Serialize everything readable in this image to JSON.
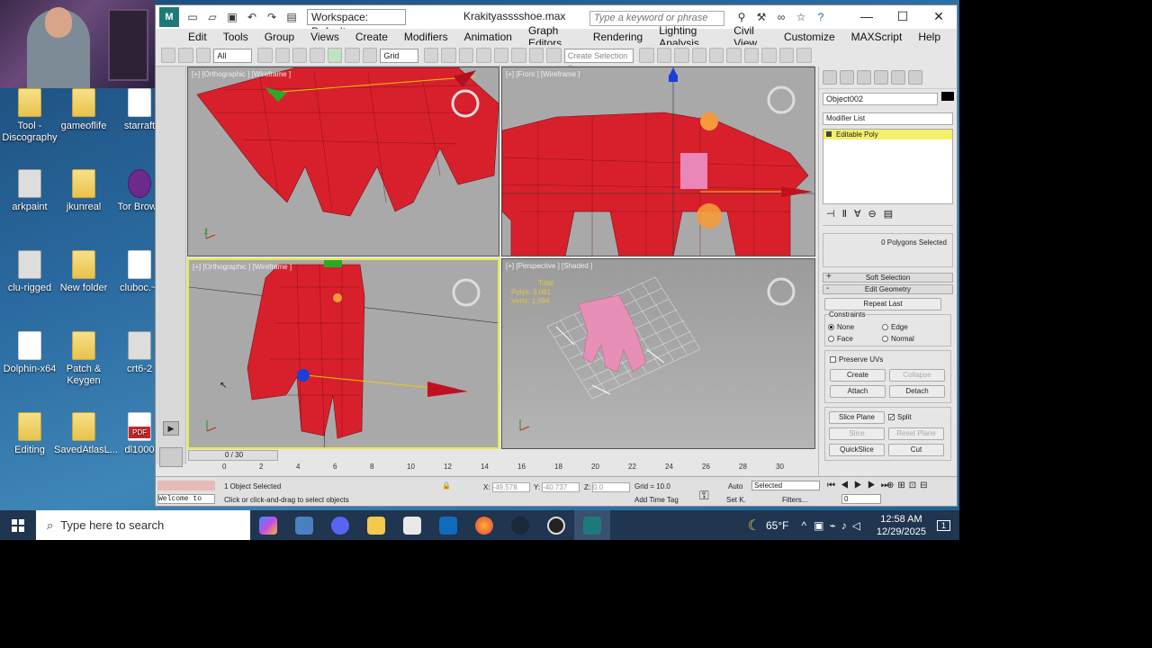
{
  "desktop": {
    "icons": [
      {
        "label": "Tool -\nDiscography",
        "kind": "folder"
      },
      {
        "label": "gameoflife",
        "kind": "folder"
      },
      {
        "label": "starraft",
        "kind": "doc"
      },
      {
        "label": "arkpaint",
        "kind": "app"
      },
      {
        "label": "jkunreal",
        "kind": "folder"
      },
      {
        "label": "Tor Brows",
        "kind": "tor"
      },
      {
        "label": "clu-rigged",
        "kind": "app"
      },
      {
        "label": "New folder",
        "kind": "folder"
      },
      {
        "label": "cluboc.~j",
        "kind": "doc"
      },
      {
        "label": "Dolphin-x64",
        "kind": "doc"
      },
      {
        "label": "Patch &\nKeygen",
        "kind": "folder"
      },
      {
        "label": "crt6-2",
        "kind": "app"
      },
      {
        "label": "Editing",
        "kind": "folder"
      },
      {
        "label": "SavedAtlasL...",
        "kind": "folder"
      },
      {
        "label": "dl1000",
        "kind": "pdf"
      }
    ]
  },
  "app": {
    "doc_title": "Krakityasssshoe.max",
    "workspace": "Workspace: Default",
    "search_placeholder": "Type a keyword or phrase",
    "menu": [
      "Edit",
      "Tools",
      "Group",
      "Views",
      "Create",
      "Modifiers",
      "Animation",
      "Graph Editors",
      "Rendering",
      "Lighting Analysis",
      "Civil View",
      "Customize",
      "MAXScript",
      "Help"
    ],
    "toolbar": {
      "selection_filter": "All",
      "ref_coord": "Grid",
      "named_selection_placeholder": "Create Selection Se"
    },
    "viewports": [
      {
        "label": "[+] [Orthographic ] [Wireframe ]"
      },
      {
        "label": "[+] [Front ] [Wireframe ]"
      },
      {
        "label": "[+] [Orthographic ] [Wireframe ]"
      },
      {
        "label": "[+] [Perspective ] [Shaded ]"
      }
    ],
    "stats": {
      "title": "Total",
      "polys_label": "Polys:",
      "polys": "3,081",
      "verts_label": "Verts:",
      "verts": "1,594"
    },
    "command_panel": {
      "object_name": "Object002",
      "modifier_list": "Modifier List",
      "stack_item": "Editable Poly",
      "selection_status": "0 Polygons Selected",
      "rollouts": [
        "Soft Selection",
        "Edit Geometry"
      ],
      "repeat_last": "Repeat Last",
      "constraints_title": "Constraints",
      "constraints": [
        "None",
        "Edge",
        "Face",
        "Normal"
      ],
      "preserve_uvs": "Preserve UVs",
      "create": "Create",
      "collapse": "Collapse",
      "attach": "Attach",
      "detach": "Detach",
      "slice_plane": "Slice Plane",
      "split": "Split",
      "slice": "Slice",
      "reset_plane": "Reset Plane",
      "quickslice": "QuickSlice",
      "cut": "Cut"
    },
    "timeline": {
      "frame_counter": "0 / 30",
      "ticks": [
        "0",
        "2",
        "4",
        "6",
        "8",
        "10",
        "12",
        "14",
        "16",
        "18",
        "20",
        "22",
        "24",
        "26",
        "28",
        "30"
      ]
    },
    "status": {
      "selected": "1 Object Selected",
      "prompt": "Click or click-and-drag to select objects",
      "welcome": "Welcome to",
      "x_label": "X:",
      "x": "-49.578",
      "y_label": "Y:",
      "y": "-40.737",
      "z_label": "Z:",
      "z": "0.0",
      "grid": "Grid = 10.0",
      "add_time_tag": "Add Time Tag",
      "auto": "Auto",
      "set_key": "Set K.",
      "key_filter": "Selected",
      "filters": "Filters...",
      "frame": "0"
    }
  },
  "taskbar": {
    "search_placeholder": "Type here to search",
    "weather": "65°F",
    "time": "12:58 AM",
    "date": "12/29/2025",
    "notifications": "1"
  },
  "colors": {
    "mesh_red": "#d8202c",
    "active_viewport": "#e8e84a",
    "desktop_blue": "#2a6aa0",
    "hand_pink": "#e88fb8"
  }
}
